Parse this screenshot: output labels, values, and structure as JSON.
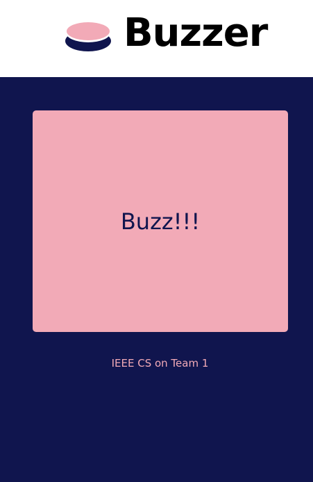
{
  "header": {
    "logo_icon": "buzzer-icon",
    "title": "Buzzer"
  },
  "main": {
    "buzz_button_label": "Buzz!!!",
    "status_text": "IEEE CS on Team 1"
  },
  "colors": {
    "background": "#10154e",
    "accent": "#f2aab7",
    "header_background": "#ffffff"
  }
}
